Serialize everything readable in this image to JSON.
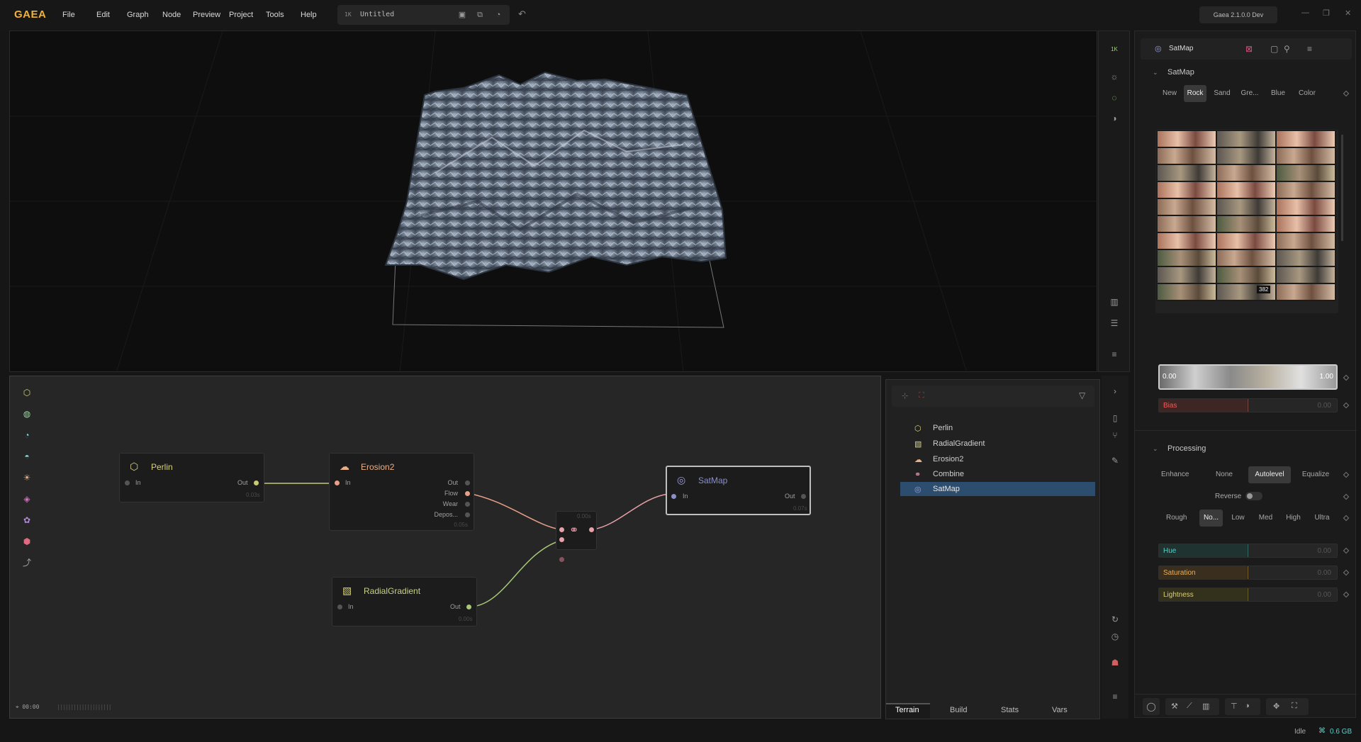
{
  "app": {
    "logo": "GAEA",
    "menu": [
      "File",
      "Edit",
      "Graph",
      "Node",
      "Preview",
      "Project",
      "Tools",
      "Help"
    ],
    "file_resolution": "1K",
    "file_name": "Untitled",
    "version": "Gaea 2.1.0.0 Dev"
  },
  "viewport": {
    "resolution_badge": "1K"
  },
  "graph": {
    "nodes": {
      "perlin": {
        "title": "Perlin",
        "in": "In",
        "out": "Out",
        "time": "0.03s"
      },
      "erosion": {
        "title": "Erosion2",
        "in": "In",
        "out": "Out",
        "flow": "Flow",
        "wear": "Wear",
        "deposits": "Depos...",
        "time": "0.05s"
      },
      "radial": {
        "title": "RadialGradient",
        "in": "In",
        "out": "Out",
        "time": "0.00s"
      },
      "combine": {
        "time": "0.00s"
      },
      "satmap": {
        "title": "SatMap",
        "in": "In",
        "out": "Out",
        "time": "0.07s"
      }
    },
    "timeline": "00:00"
  },
  "layers": {
    "items": [
      {
        "label": "Perlin",
        "icon": "hexagon-icon",
        "color": "#d8d27a"
      },
      {
        "label": "RadialGradient",
        "icon": "gradient-icon",
        "color": "#d8d27a"
      },
      {
        "label": "Erosion2",
        "icon": "erosion-icon",
        "color": "#e8b08a"
      },
      {
        "label": "Combine",
        "icon": "combine-icon",
        "color": "#e09aa8"
      },
      {
        "label": "SatMap",
        "icon": "satmap-icon",
        "color": "#9aa0d8"
      }
    ],
    "tabs": [
      "Terrain",
      "Build",
      "Stats",
      "Vars"
    ]
  },
  "properties": {
    "node_name": "SatMap",
    "section1": "SatMap",
    "lib_tabs": [
      "New",
      "Rock",
      "Sand",
      "Gre...",
      "Blue",
      "Color"
    ],
    "lib_active": "Rock",
    "selected_count": "382",
    "range_min": "0.00",
    "range_max": "1.00",
    "bias_label": "Bias",
    "bias_value": "0.00",
    "section2": "Processing",
    "enhance_label": "Enhance",
    "enhance_opts": [
      "None",
      "Autolevel",
      "Equalize"
    ],
    "enhance_active": "Autolevel",
    "reverse_label": "Reverse",
    "rough_label": "Rough",
    "rough_opts": [
      "No...",
      "Low",
      "Med",
      "High",
      "Ultra"
    ],
    "rough_active": "No...",
    "hue_label": "Hue",
    "hue_value": "0.00",
    "sat_label": "Saturation",
    "sat_value": "0.00",
    "light_label": "Lightness",
    "light_value": "0.00"
  },
  "status": {
    "state": "Idle",
    "memory": "0.6 GB"
  },
  "colors": {
    "accent": "#f2b233",
    "selection": "#2c4d6d"
  }
}
